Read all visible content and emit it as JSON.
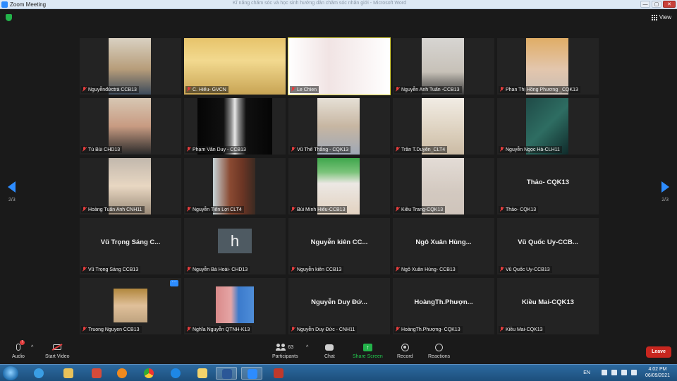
{
  "window": {
    "title": "Zoom Meeting",
    "background_title": "Kĩ năng chăm sóc và học sinh hướng dẫn chăm sóc nhân giới - Microsoft Word",
    "controls": [
      "—",
      "▢",
      "✕"
    ]
  },
  "topbar": {
    "view_label": "View",
    "security_icon": "shield-check-icon"
  },
  "pagination": {
    "left": "2/3",
    "right": "2/3"
  },
  "tiles": [
    {
      "name": "Nguyễnđứctrà CCB13",
      "video": "v-room1",
      "muted": true
    },
    {
      "name": "C. Hiếu- GVCN",
      "video": "v-teacher",
      "muted": true
    },
    {
      "name": "Le Chien",
      "video": "v-lechien",
      "muted": true,
      "active": true
    },
    {
      "name": "Nguyễn Anh Tuấn -CCB13",
      "video": "v-room2",
      "muted": true
    },
    {
      "name": "Phan Thị Hồng Phương _CQK13",
      "video": "v-face1",
      "muted": true
    },
    {
      "name": "Tú Bùi CHD13",
      "video": "v-tubui",
      "muted": true
    },
    {
      "name": "Phạm Văn Duy - CCB13",
      "video": "v-dark",
      "muted": true
    },
    {
      "name": "Vũ Thế Thắng - CQK13",
      "video": "v-blur1",
      "muted": true
    },
    {
      "name": "Trần T.Duyên_CLT4",
      "video": "v-blur2",
      "muted": true
    },
    {
      "name": "Nguyễn Ngọc Hà-CLH11",
      "video": "v-teal",
      "muted": true
    },
    {
      "name": "Hoàng Tuấn Anh CNH11",
      "video": "v-hoang",
      "muted": true
    },
    {
      "name": "Nguyễn Tiến Lợi CLT4",
      "video": "v-shelf",
      "muted": true
    },
    {
      "name": "Bùi Minh Hiếu-CCB13",
      "video": "v-green",
      "muted": true
    },
    {
      "name": "Kiều Trang-CQK13",
      "video": "v-wall",
      "muted": true
    },
    {
      "name": "Thảo- CQK13",
      "display": "Thảo- CQK13",
      "muted": true
    },
    {
      "name": "Vũ Trọng Sáng CCB13",
      "display": "Vũ Trọng Sáng C...",
      "muted": true
    },
    {
      "name": "Nguyễn Bá Hoài- CHD13",
      "avatar_letter": "h",
      "muted": true
    },
    {
      "name": "Nguyễn kiên CCB13",
      "display": "Nguyễn kiên CC...",
      "muted": true
    },
    {
      "name": "Ngô Xuân Hùng- CCB13",
      "display": "Ngô Xuân Hùng...",
      "muted": true
    },
    {
      "name": "Vũ Quốc Uy-CCB13",
      "display": "Vũ Quốc Uy-CCB...",
      "muted": true
    },
    {
      "name": "Truong Nguyen CCB13",
      "video": "v-truong",
      "muted": true,
      "more": "···"
    },
    {
      "name": "Nghĩa Nguyễn QTNH-K13",
      "video": "v-nghia",
      "muted": true
    },
    {
      "name": "Nguyễn Duy Đức - CNH11",
      "display": "Nguyễn Duy Đứ...",
      "muted": true
    },
    {
      "name": "HoàngTh.Phượng- CQK13",
      "display": "HoàngTh.Phượn...",
      "muted": true
    },
    {
      "name": "Kiều Mai-CQK13",
      "display": "Kiều Mai-CQK13",
      "muted": true
    }
  ],
  "toolbar": {
    "audio": "Audio",
    "video": "Start Video",
    "participants": "Participants",
    "participants_count": "63",
    "chat": "Chat",
    "share": "Share Screen",
    "record": "Record",
    "reactions": "Reactions",
    "leave": "Leave",
    "audio_badge": "!"
  },
  "taskbar": {
    "lang": "EN",
    "time": "4:02 PM",
    "date": "06/09/2021"
  },
  "colors": {
    "accent": "#2d8cff",
    "share_green": "#23b34a",
    "leave_red": "#c8261f",
    "active_border": "#d9d23c"
  }
}
